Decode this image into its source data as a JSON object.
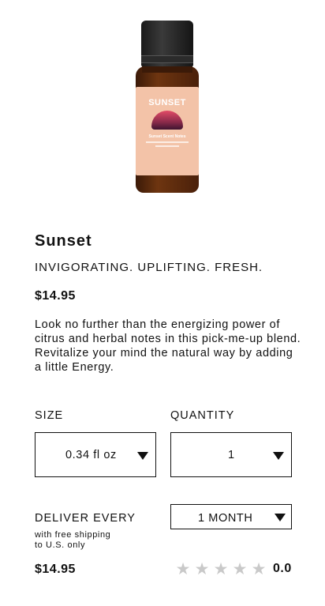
{
  "product": {
    "image_alt": "Sunset essential oil bottle",
    "label_title": "SUNSET",
    "label_subtitle": "Sunset Scent Notes",
    "title": "Sunset",
    "tagline": "INVIGORATING. UPLIFTING. FRESH.",
    "price": "$14.95",
    "description": "Look no further than the energizing power of citrus and herbal notes in this pick-me-up blend. Revitalize your mind the natural way by adding a little Energy."
  },
  "options": {
    "size_label": "SIZE",
    "size_value": "0.34 fl oz",
    "quantity_label": "QUANTITY",
    "quantity_value": "1"
  },
  "subscription": {
    "deliver_label": "DELIVER EVERY",
    "frequency_value": "1 MONTH",
    "shipping_line1": "with free shipping",
    "shipping_line2": "to U.S. only",
    "price": "$14.95"
  },
  "rating": {
    "value": "0.0",
    "stars_filled": 0,
    "stars_total": 5,
    "star_glyph": "★",
    "star_color": "#c9c9c9"
  },
  "colors": {
    "text": "#111111",
    "label_peach": "#f3c3a8",
    "bottle_amber": "#6e3510"
  }
}
